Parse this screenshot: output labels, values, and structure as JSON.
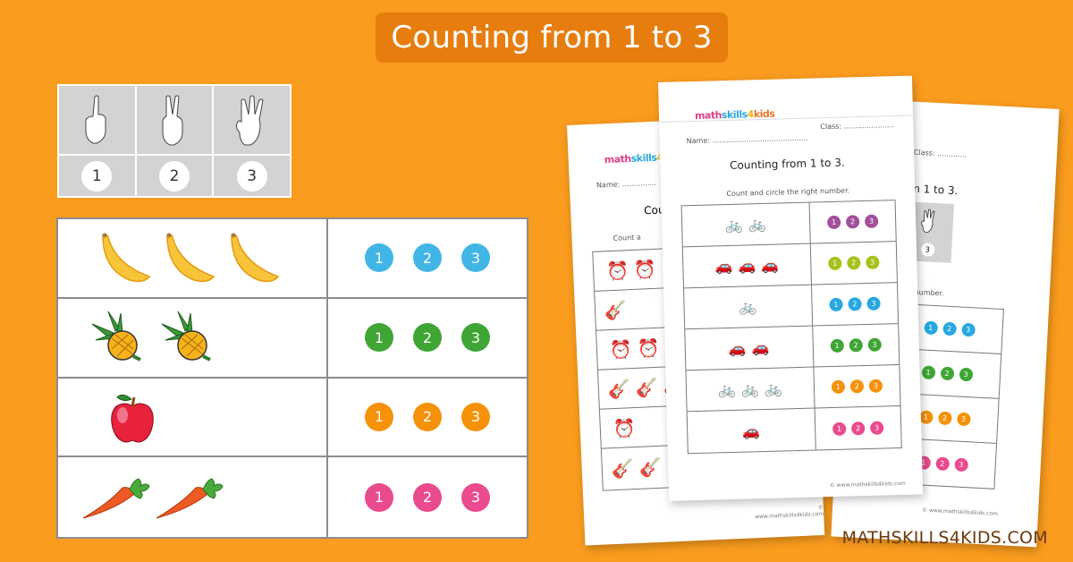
{
  "title": "Counting from 1 to 3",
  "finger_table": {
    "fingers": [
      {
        "icon": "one-finger-hand-icon",
        "number": "1"
      },
      {
        "icon": "two-fingers-hand-icon",
        "number": "2"
      },
      {
        "icon": "three-fingers-hand-icon",
        "number": "3"
      }
    ]
  },
  "count_table": {
    "rows": [
      {
        "item": "banana",
        "count": 3,
        "numbers": [
          "1",
          "2",
          "3"
        ],
        "color": "#41b6e6"
      },
      {
        "item": "pineapple",
        "count": 2,
        "numbers": [
          "1",
          "2",
          "3"
        ],
        "color": "#3fa535"
      },
      {
        "item": "apple",
        "count": 1,
        "numbers": [
          "1",
          "2",
          "3"
        ],
        "color": "#f5920a"
      },
      {
        "item": "carrot",
        "count": 2,
        "numbers": [
          "1",
          "2",
          "3"
        ],
        "color": "#ea4a8e"
      }
    ]
  },
  "worksheet": {
    "logo": {
      "part1": "math",
      "part2": "skills",
      "part3": "4",
      "part4": "kids"
    },
    "name_label": "Name",
    "class_label": "Class:",
    "heading": "Counting from 1 to 3.",
    "instruction": "Count and circle the right number.",
    "footer": "© www.mathskills4kids.com",
    "front_rows": [
      {
        "item": "bicycle",
        "count": 2,
        "color": "#a34f9b"
      },
      {
        "item": "car",
        "count": 3,
        "color": "#a6c31c"
      },
      {
        "item": "bicycle",
        "count": 1,
        "color": "#28a8e0"
      },
      {
        "item": "car",
        "count": 2,
        "color": "#3fa535"
      },
      {
        "item": "bicycle",
        "count": 3,
        "color": "#f5920a"
      },
      {
        "item": "car",
        "count": 1,
        "color": "#ea4a8e"
      }
    ],
    "left_rows": [
      {
        "item": "alarm-clock",
        "count": 2
      },
      {
        "item": "guitar",
        "count": 1
      },
      {
        "item": "alarm-clock",
        "count": 2
      },
      {
        "item": "guitar",
        "count": 3
      },
      {
        "item": "alarm-clock",
        "count": 1
      },
      {
        "item": "guitar",
        "count": 2
      }
    ],
    "right_rows_colors": [
      "#28a8e0",
      "#3fa535",
      "#f5920a",
      "#ea4a8e"
    ],
    "right_heading_partial": "om 1 to 3.",
    "right_instruction_partial": "e right number."
  },
  "brand": "MATHSKILLS4KIDS.COM"
}
